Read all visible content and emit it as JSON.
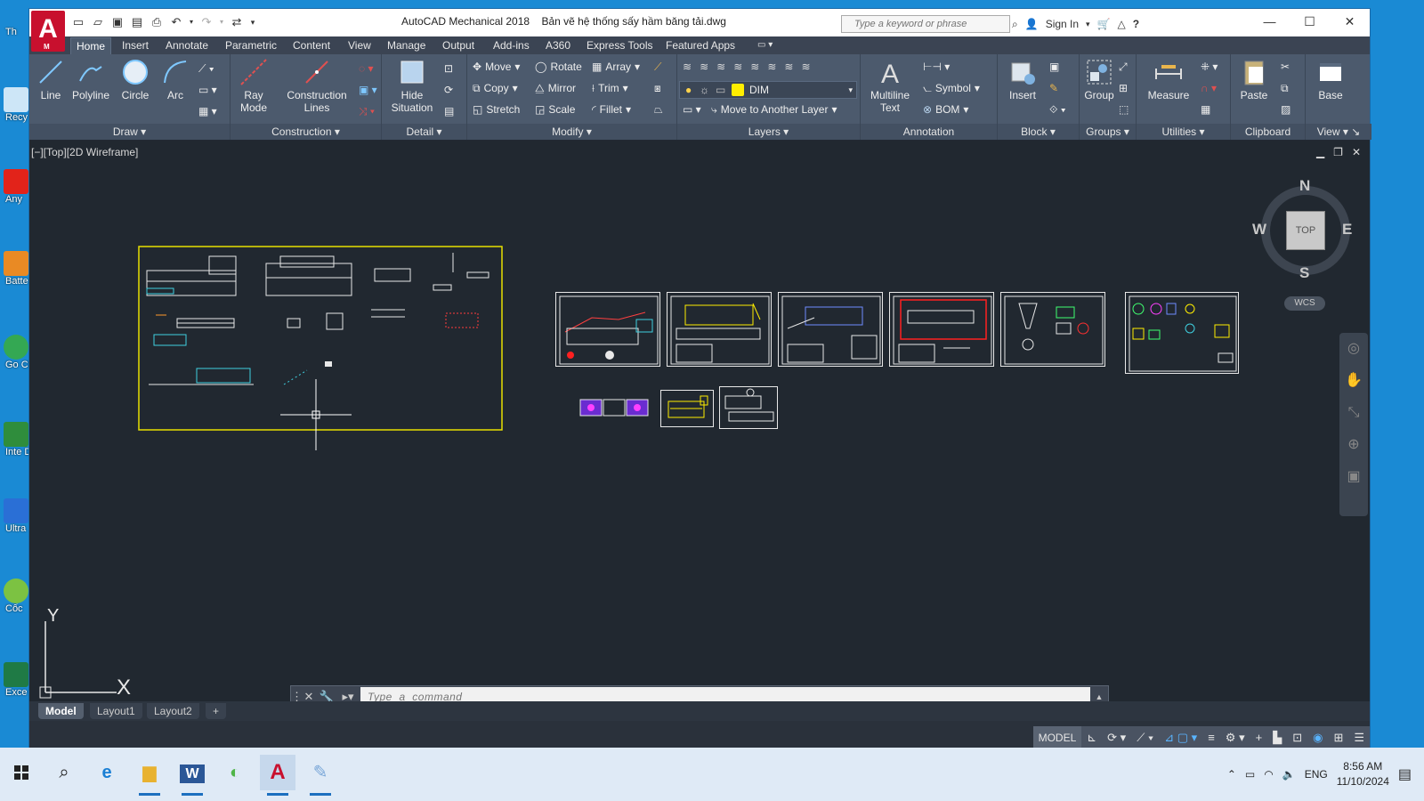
{
  "desktop": {
    "icons": [
      {
        "label": "Th",
        "color": "#ffffff"
      },
      {
        "label": "Recy",
        "color": "#cde6f7"
      },
      {
        "label": "Any",
        "color": "#e2231a"
      },
      {
        "label": "Batte",
        "color": "#e98a24"
      },
      {
        "label": "Go Ch",
        "color": "#34a853"
      },
      {
        "label": "Inte Dov",
        "color": "#2f8d3c"
      },
      {
        "label": "Ultra",
        "color": "#2a6fd6"
      },
      {
        "label": "Cốc",
        "color": "#7cc242"
      },
      {
        "label": "Exce",
        "color": "#1f7a45"
      }
    ]
  },
  "window": {
    "app_logo": "A",
    "app_logo_sub": "M",
    "app_title": "AutoCAD Mechanical 2018",
    "file_title": "Bản vẽ hệ thống sấy hầm băng tải.dwg",
    "search_placeholder": "Type a keyword or phrase",
    "sign_in": "Sign In",
    "help": "?",
    "minimize": "—",
    "maximize": "☐",
    "close": "✕"
  },
  "ribbon": {
    "tabs": [
      "Home",
      "Insert",
      "Annotate",
      "Parametric",
      "Content",
      "View",
      "Manage",
      "Output",
      "Add-ins",
      "A360",
      "Express Tools",
      "Featured Apps"
    ],
    "active_tab": "Home",
    "panels": {
      "draw": {
        "title": "Draw",
        "line": "Line",
        "polyline": "Polyline",
        "circle": "Circle",
        "arc": "Arc"
      },
      "construction": {
        "title": "Construction",
        "ray": "Ray Mode",
        "lines": "Construction Lines"
      },
      "detail": {
        "title": "Detail",
        "hide": "Hide Situation"
      },
      "modify": {
        "title": "Modify",
        "move": "Move",
        "rotate": "Rotate",
        "array": "Array",
        "copy": "Copy",
        "mirror": "Mirror",
        "trim": "Trim",
        "stretch": "Stretch",
        "scale": "Scale",
        "fillet": "Fillet"
      },
      "layers": {
        "title": "Layers",
        "current_layer": "DIM",
        "move_to_layer": "Move to Another Layer"
      },
      "annotation": {
        "title": "Annotation",
        "mtext": "Multiline Text",
        "symbol": "Symbol",
        "bom": "BOM"
      },
      "block": {
        "title": "Block",
        "insert": "Insert"
      },
      "groups": {
        "title": "Groups",
        "group": "Group"
      },
      "utilities": {
        "title": "Utilities",
        "measure": "Measure"
      },
      "clipboard": {
        "title": "Clipboard",
        "paste": "Paste"
      },
      "view": {
        "title": "View",
        "base": "Base"
      }
    }
  },
  "viewport": {
    "label": "[−][Top][2D Wireframe]",
    "viewcube": {
      "north": "N",
      "south": "S",
      "east": "E",
      "west": "W",
      "face": "TOP"
    },
    "wcs": "WCS",
    "ucs_x": "X",
    "ucs_y": "Y"
  },
  "command": {
    "placeholder": "Type  a  command"
  },
  "layout_tabs": [
    "Model",
    "Layout1",
    "Layout2"
  ],
  "add_tab": "+",
  "status": {
    "model": "MODEL"
  },
  "taskbar": {
    "lang": "ENG",
    "time": "8:56 AM",
    "date": "11/10/2024"
  }
}
